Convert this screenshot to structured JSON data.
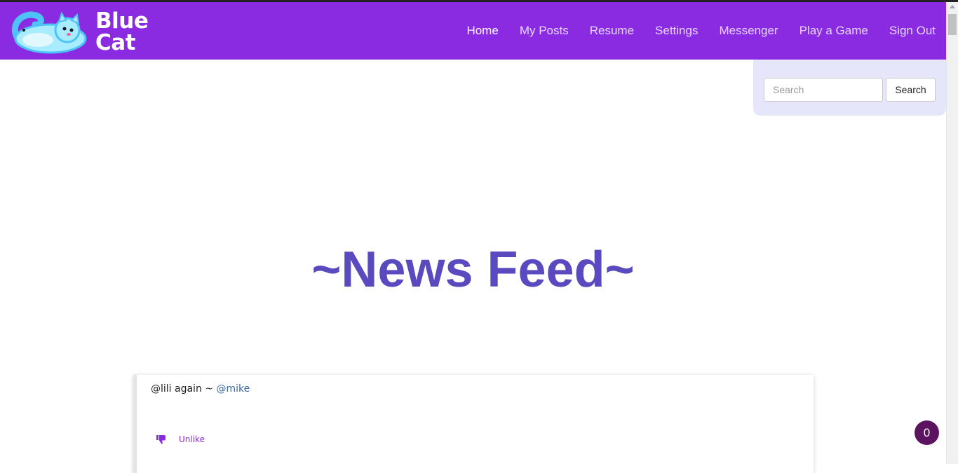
{
  "brand": {
    "name_line1": "Blue",
    "name_line2": "Cat"
  },
  "nav": {
    "items": [
      {
        "label": "Home",
        "active": true
      },
      {
        "label": "My Posts"
      },
      {
        "label": "Resume"
      },
      {
        "label": "Settings"
      },
      {
        "label": "Messenger"
      },
      {
        "label": "Play a Game"
      },
      {
        "label": "Sign Out"
      }
    ]
  },
  "search": {
    "placeholder": "Search",
    "button_label": "Search"
  },
  "main": {
    "title": "~News Feed~"
  },
  "posts": [
    {
      "text": "@lili again ~ ",
      "mention": "@mike",
      "action_label": "Unlike"
    }
  ],
  "badge": {
    "count": "0"
  },
  "colors": {
    "navbar": "#8a2be2",
    "title": "#5a4abf",
    "search_panel": "#e6e6fa",
    "badge": "#5c1460"
  },
  "icons": {
    "logo": "cat-logo-icon",
    "unlike": "thumbs-down-icon"
  }
}
